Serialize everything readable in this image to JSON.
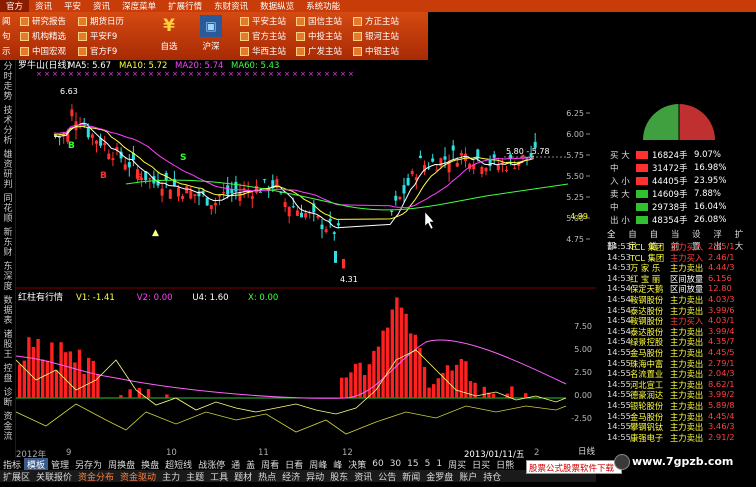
{
  "menu": [
    "官方",
    "资讯",
    "平安",
    "资讯",
    "深度菜单",
    "扩展行情",
    "东财资讯",
    "数据纵览",
    "系统功能"
  ],
  "toolbar": {
    "row1": [
      "研究报告",
      "期货日历",
      "平安主站",
      "国信主站",
      "方正主站"
    ],
    "row2": [
      "机构精选",
      "平安F9",
      "官方主站",
      "中投主站",
      "银河主站"
    ],
    "row3": [
      "中国宏观",
      "官方F9",
      "华西主站",
      "广发主站",
      "中银主站"
    ],
    "left_frag": [
      "闻",
      "句",
      "示"
    ],
    "big": [
      {
        "icon": "¥",
        "label": "自选"
      },
      {
        "icon": "▣",
        "label": "沪深"
      }
    ]
  },
  "chart": {
    "stock_title": "罗牛山(日线)",
    "ma": [
      {
        "label": "MA5: 5.67",
        "color": "#ffffff"
      },
      {
        "label": "MA10: 5.72",
        "color": "#ffff40"
      },
      {
        "label": "MA20: 5.74",
        "color": "#ff40ff"
      },
      {
        "label": "MA60: 5.43",
        "color": "#40ff40"
      }
    ],
    "high_label": "6.63",
    "low_label": "4.31",
    "cur_label": "5.80 - 5.78",
    "price_ticks": [
      "6.25",
      "6.00",
      "5.75",
      "5.50",
      "5.25",
      "5.00",
      "4.75"
    ],
    "right_value": "4.99",
    "sub_title": "红柱有行情",
    "sub_vals": [
      {
        "label": "V1: -1.41",
        "color": "#ffff40"
      },
      {
        "label": "V2: 0.00",
        "color": "#ff40ff"
      },
      {
        "label": "U4: 1.60",
        "color": "#ffffff"
      },
      {
        "label": "X: 0.00",
        "color": "#40ff40"
      }
    ],
    "sub_ticks": [
      "7.50",
      "5.00",
      "2.50",
      "0.00",
      "-2.50"
    ],
    "markers": [
      "B",
      "B",
      "S",
      "S"
    ]
  },
  "dates": [
    "2012年",
    "9",
    "10",
    "11",
    "12",
    "2013/01/11/五",
    "2"
  ],
  "vtabs": [
    "分时走势",
    "技术分析",
    "雄资研判",
    "同花顺",
    "新东财",
    "东深度",
    "数据表",
    "诸股王",
    "控盘",
    "诊断",
    "资金流"
  ],
  "chart_data": {
    "type": "bar",
    "volume_buy_sell": {
      "rows": [
        {
          "name": "买 大",
          "color": "#ff3030",
          "value": "16824手",
          "pct": "9.07%"
        },
        {
          "name": "中",
          "color": "#ff3030",
          "value": "31472手",
          "pct": "16.98%"
        },
        {
          "name": "入 小",
          "color": "#ff3030",
          "value": "44405手",
          "pct": "23.95%"
        },
        {
          "name": "卖 大",
          "color": "#30c030",
          "value": "14609手",
          "pct": "7.88%"
        },
        {
          "name": "中",
          "color": "#30c030",
          "value": "29738手",
          "pct": "16.04%"
        },
        {
          "name": "出 小",
          "color": "#30c030",
          "value": "48354手",
          "pct": "26.08%"
        }
      ]
    }
  },
  "panel": {
    "tabs": [
      "全部",
      "自定",
      "自选",
      "当前",
      "设置",
      "浮出",
      "扩大"
    ],
    "ticks": [
      {
        "t": "14:53",
        "n": "TCL 集团",
        "a": "主力买入",
        "v": "2.45/1"
      },
      {
        "t": "14:53",
        "n": "TCL 集团",
        "a": "主力买入",
        "v": "2.46/1"
      },
      {
        "t": "14:53",
        "n": "万 家 乐",
        "a": "主力卖出",
        "v": "4.44/3"
      },
      {
        "t": "14:53",
        "n": "红 宝 丽",
        "a": "区间放量",
        "v": "6.156"
      },
      {
        "t": "14:54",
        "n": "保定天鹅",
        "a": "区间放量",
        "v": "12.80"
      },
      {
        "t": "14:54",
        "n": "鞍钢股份",
        "a": "主力卖出",
        "v": "4.03/3"
      },
      {
        "t": "14:54",
        "n": "泰达股份",
        "a": "主力卖出",
        "v": "3.99/6"
      },
      {
        "t": "14:54",
        "n": "鞍钢股份",
        "a": "主力买入",
        "v": "4.03/1"
      },
      {
        "t": "14:54",
        "n": "泰达股份",
        "a": "主力卖出",
        "v": "3.99/4"
      },
      {
        "t": "14:54",
        "n": "绿景控股",
        "a": "主力卖出",
        "v": "4.35/7"
      },
      {
        "t": "14:55",
        "n": "金马股份",
        "a": "主力卖出",
        "v": "4.45/5"
      },
      {
        "t": "14:55",
        "n": "珠海中富",
        "a": "主力卖出",
        "v": "2.79/1"
      },
      {
        "t": "14:55",
        "n": "名流置业",
        "a": "主力卖出",
        "v": "2.04/3"
      },
      {
        "t": "14:55",
        "n": "河北宣工",
        "a": "主力卖出",
        "v": "8.62/1"
      },
      {
        "t": "14:55",
        "n": "德豪润达",
        "a": "主力卖出",
        "v": "3.99/2"
      },
      {
        "t": "14:55",
        "n": "银轮股份",
        "a": "主力卖出",
        "v": "5.89/8"
      },
      {
        "t": "14:55",
        "n": "金马股份",
        "a": "主力卖出",
        "v": "4.45/4"
      },
      {
        "t": "14:55",
        "n": "攀钢钒钛",
        "a": "主力卖出",
        "v": "3.46/3"
      },
      {
        "t": "14:55",
        "n": "康强电子",
        "a": "主力卖出",
        "v": "2.91/2"
      }
    ],
    "period": "日线"
  },
  "bottom1": [
    "指标",
    "模板",
    "管理",
    "另存为",
    "周换盘",
    "换盘",
    "超短线",
    "战涨停",
    "通",
    "盖",
    "周看",
    "日看",
    "周峰",
    "峰",
    "决策",
    "60",
    "30",
    "15",
    "5",
    "1",
    "周买",
    "日买",
    "日熊"
  ],
  "bottom2": [
    "扩展区",
    "关联报价",
    "资金分布",
    "资金驱动",
    "主力",
    "主题",
    "工具",
    "题材",
    "热点",
    "经济",
    "异动",
    "股东",
    "资讯",
    "公告",
    "新闻",
    "金罗盘",
    "账户",
    "持仓"
  ],
  "popup": "股票公式股票软件下载",
  "watermark": "www.7gpzb.com"
}
